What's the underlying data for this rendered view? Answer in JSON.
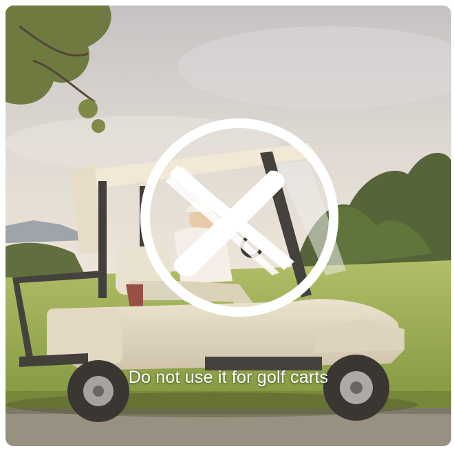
{
  "caption": "Do not use it for golf carts",
  "colors": {
    "sky_top": "#c9c8cc",
    "sky_bottom": "#e8e4de",
    "grass": "#8fa83a",
    "cart_body": "#ded7c4",
    "canopy": "#efe9d8",
    "mark": "#ffffff"
  },
  "icons": [
    "prohibited-circle-icon",
    "brush-x-icon"
  ]
}
